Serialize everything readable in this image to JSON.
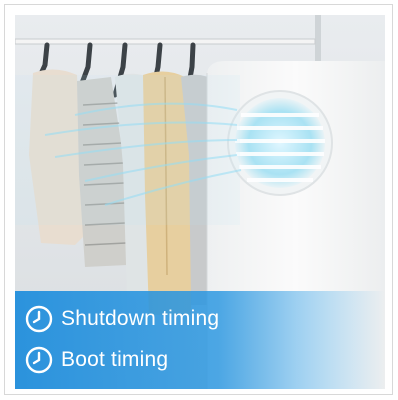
{
  "banner": {
    "features": [
      {
        "label": "Shutdown timing",
        "icon": "clock-icon"
      },
      {
        "label": "Boot timing",
        "icon": "clock-icon"
      }
    ]
  },
  "colors": {
    "banner_blue": "#1c8cdc",
    "airflow": "#8fdcf5",
    "device_white": "#f7f8f8"
  }
}
